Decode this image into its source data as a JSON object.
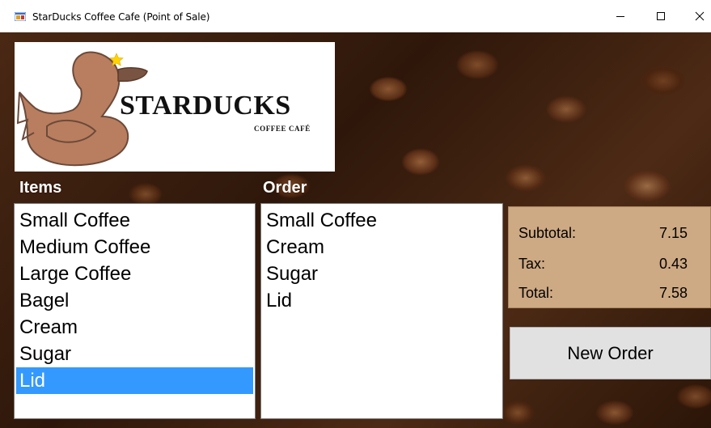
{
  "window": {
    "title": "StarDucks Coffee Cafe (Point of Sale)",
    "controls": {
      "minimize": "minimize-icon",
      "maximize": "maximize-icon",
      "close": "close-icon"
    }
  },
  "logo": {
    "name": "STARDUCKS",
    "tagline": "COFFEE CAFÉ",
    "colors": {
      "duck": "#b97e5f",
      "star": "#ffd400",
      "outline": "#6b4a3a"
    }
  },
  "items": {
    "label": "Items",
    "list": [
      "Small Coffee",
      "Medium Coffee",
      "Large Coffee",
      "Bagel",
      "Cream",
      "Sugar",
      "Lid"
    ],
    "selected_index": 6
  },
  "order": {
    "label": "Order",
    "list": [
      "Small Coffee",
      "Cream",
      "Sugar",
      "Lid"
    ]
  },
  "totals": {
    "subtotal_label": "Subtotal:",
    "subtotal": "7.15",
    "tax_label": "Tax:",
    "tax": "0.43",
    "total_label": "Total:",
    "total": "7.58"
  },
  "actions": {
    "new_order": "New Order"
  },
  "colors": {
    "selection": "#3399ff",
    "totals_panel": "#cda984",
    "button": "#e1e1e1"
  }
}
